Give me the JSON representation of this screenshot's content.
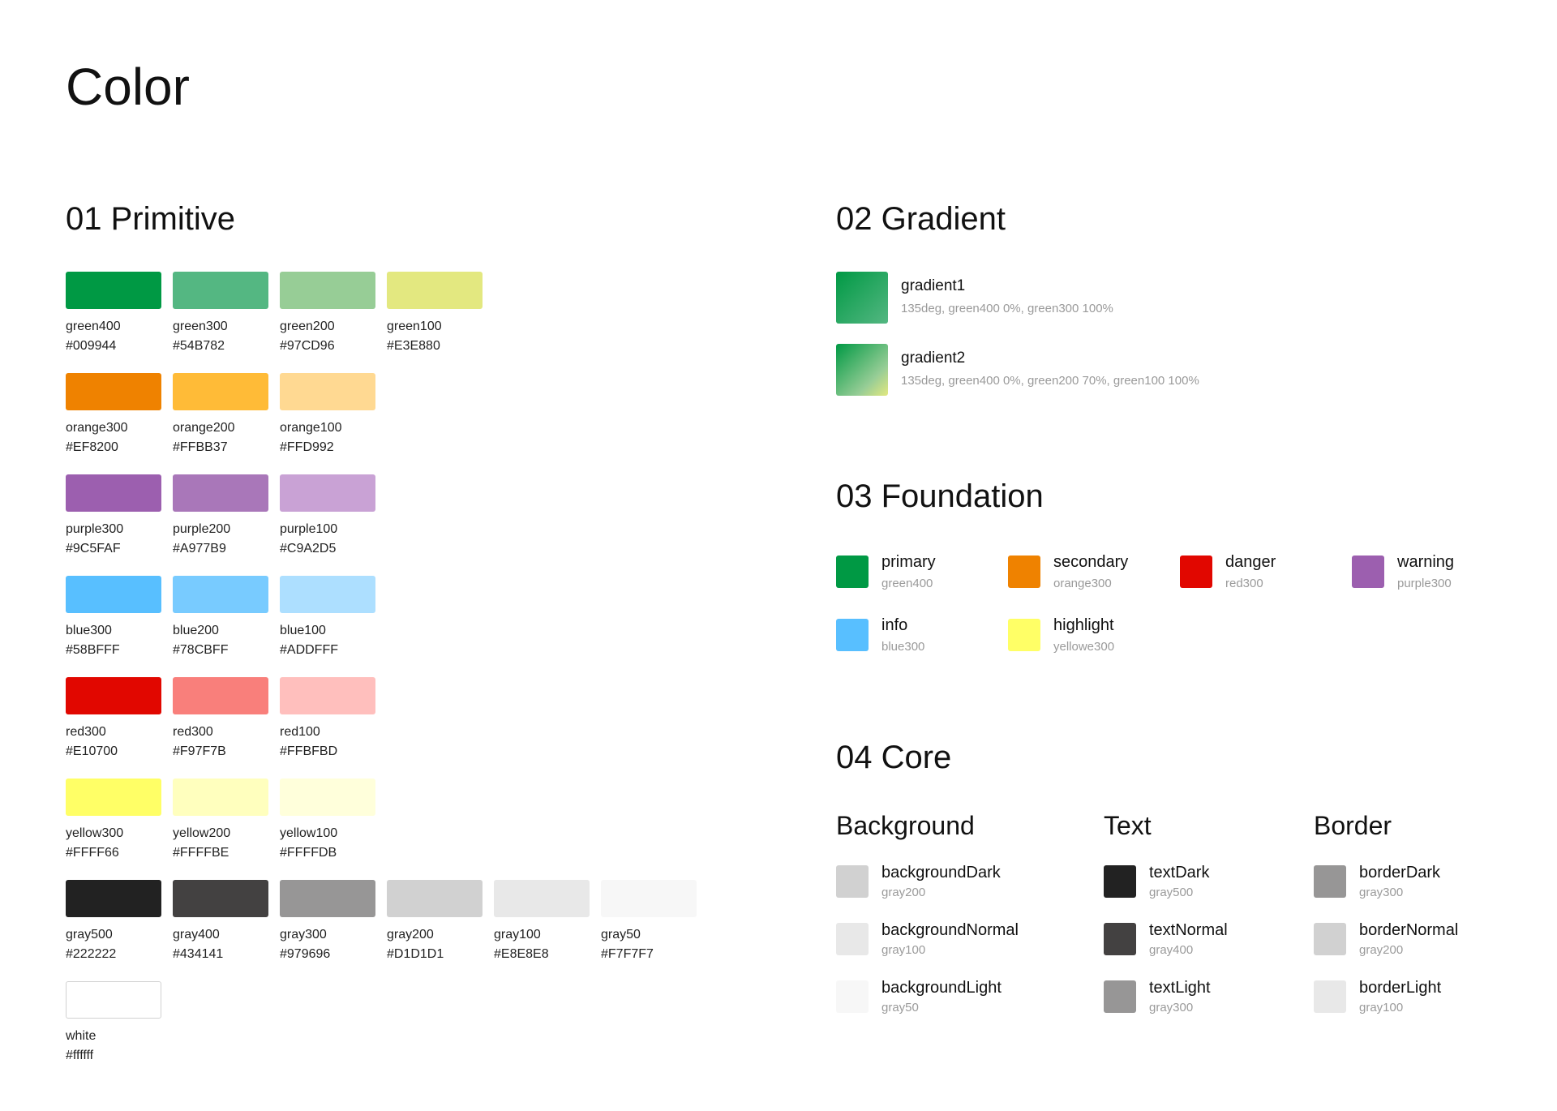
{
  "page_title": "Color",
  "primitive": {
    "title": "01 Primitive",
    "rows": [
      [
        {
          "name": "green400",
          "hex": "#009944"
        },
        {
          "name": "green300",
          "hex": "#54B782"
        },
        {
          "name": "green200",
          "hex": "#97CD96"
        },
        {
          "name": "green100",
          "hex": "#E3E880"
        }
      ],
      [
        {
          "name": "orange300",
          "hex": "#EF8200"
        },
        {
          "name": "orange200",
          "hex": "#FFBB37"
        },
        {
          "name": "orange100",
          "hex": "#FFD992"
        }
      ],
      [
        {
          "name": "purple300",
          "hex": "#9C5FAF"
        },
        {
          "name": "purple200",
          "hex": "#A977B9"
        },
        {
          "name": "purple100",
          "hex": "#C9A2D5"
        }
      ],
      [
        {
          "name": "blue300",
          "hex": "#58BFFF"
        },
        {
          "name": "blue200",
          "hex": "#78CBFF"
        },
        {
          "name": "blue100",
          "hex": "#ADDFFF"
        }
      ],
      [
        {
          "name": "red300",
          "hex": "#E10700"
        },
        {
          "name": "red300",
          "hex": "#F97F7B"
        },
        {
          "name": "red100",
          "hex": "#FFBFBD"
        }
      ],
      [
        {
          "name": "yellow300",
          "hex": "#FFFF66"
        },
        {
          "name": "yellow200",
          "hex": "#FFFFBE"
        },
        {
          "name": "yellow100",
          "hex": "#FFFFDB"
        }
      ],
      [
        {
          "name": "gray500",
          "hex": "#222222"
        },
        {
          "name": "gray400",
          "hex": "#434141"
        },
        {
          "name": "gray300",
          "hex": "#979696"
        },
        {
          "name": "gray200",
          "hex": "#D1D1D1"
        },
        {
          "name": "gray100",
          "hex": "#E8E8E8"
        },
        {
          "name": "gray50",
          "hex": "#F7F7F7"
        }
      ],
      [
        {
          "name": "white",
          "hex": "#ffffff",
          "outlined": true
        }
      ]
    ]
  },
  "gradient": {
    "title": "02 Gradient",
    "items": [
      {
        "name": "gradient1",
        "desc": "135deg, green400 0%, green300 100%",
        "css": "linear-gradient(135deg, #009944 0%, #54B782 100%)"
      },
      {
        "name": "gradient2",
        "desc": "135deg, green400 0%, green200 70%, green100 100%",
        "css": "linear-gradient(135deg, #009944 0%, #97CD96 70%, #E3E880 100%)"
      }
    ]
  },
  "foundation": {
    "title": "03 Foundation",
    "rows": [
      [
        {
          "name": "primary",
          "sub": "green400",
          "color": "#009944"
        },
        {
          "name": "secondary",
          "sub": "orange300",
          "color": "#EF8200"
        },
        {
          "name": "danger",
          "sub": "red300",
          "color": "#E10700"
        },
        {
          "name": "warning",
          "sub": "purple300",
          "color": "#9C5FAF"
        }
      ],
      [
        {
          "name": "info",
          "sub": "blue300",
          "color": "#58BFFF"
        },
        {
          "name": "highlight",
          "sub": "yellowe300",
          "color": "#FFFF66"
        }
      ]
    ]
  },
  "core": {
    "title": "04 Core",
    "columns": [
      {
        "heading": "Background",
        "items": [
          {
            "name": "backgroundDark",
            "sub": "gray200",
            "color": "#D1D1D1"
          },
          {
            "name": "backgroundNormal",
            "sub": "gray100",
            "color": "#E8E8E8"
          },
          {
            "name": "backgroundLight",
            "sub": "gray50",
            "color": "#F7F7F7"
          }
        ]
      },
      {
        "heading": "Text",
        "items": [
          {
            "name": "textDark",
            "sub": "gray500",
            "color": "#222222"
          },
          {
            "name": "textNormal",
            "sub": "gray400",
            "color": "#434141"
          },
          {
            "name": "textLight",
            "sub": "gray300",
            "color": "#979696"
          }
        ]
      },
      {
        "heading": "Border",
        "items": [
          {
            "name": "borderDark",
            "sub": "gray300",
            "color": "#979696"
          },
          {
            "name": "borderNormal",
            "sub": "gray200",
            "color": "#D1D1D1"
          },
          {
            "name": "borderLight",
            "sub": "gray100",
            "color": "#E8E8E8"
          }
        ]
      }
    ]
  }
}
